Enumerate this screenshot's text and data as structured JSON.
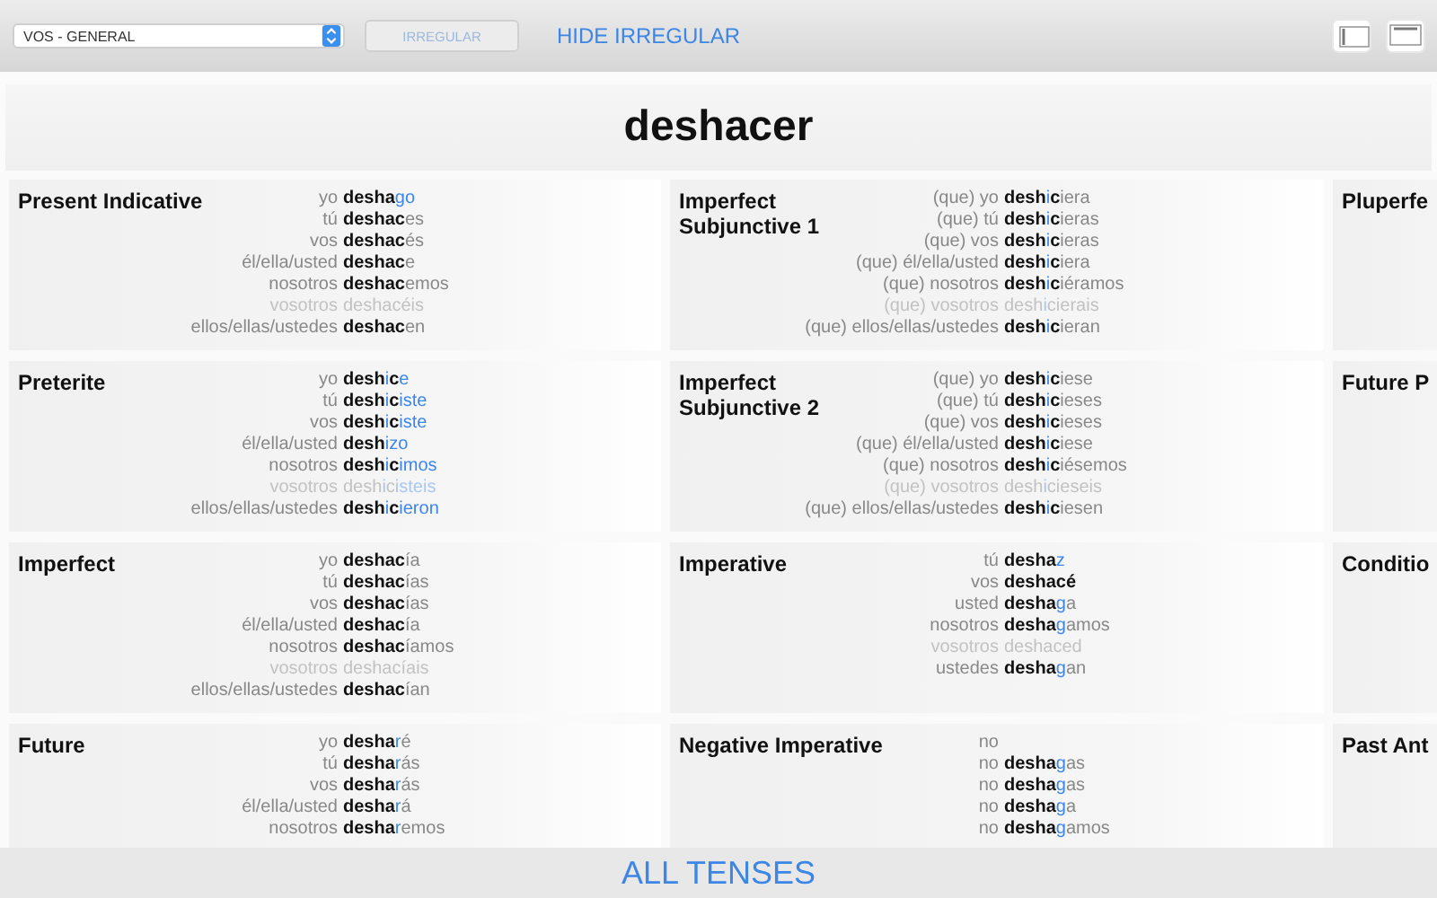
{
  "toolbar": {
    "dropdown": {
      "value": "VOS - GENERAL"
    },
    "irregular_button": {
      "label": "IRREGULAR",
      "disabled": true
    },
    "hide_irregular_link": "HIDE IRREGULAR"
  },
  "verb": "deshacer",
  "tenses": [
    {
      "title": "Present Indicative",
      "forms": [
        {
          "pronoun": "yo",
          "faded": false,
          "parts": [
            {
              "text": "desha",
              "kind": "stem"
            },
            {
              "text": "go",
              "kind": "irregular"
            }
          ]
        },
        {
          "pronoun": "tú",
          "faded": false,
          "parts": [
            {
              "text": "deshac",
              "kind": "stem"
            },
            {
              "text": "es",
              "kind": "ending"
            }
          ]
        },
        {
          "pronoun": "vos",
          "faded": false,
          "parts": [
            {
              "text": "deshac",
              "kind": "stem"
            },
            {
              "text": "és",
              "kind": "ending"
            }
          ]
        },
        {
          "pronoun": "él/ella/usted",
          "faded": false,
          "parts": [
            {
              "text": "deshac",
              "kind": "stem"
            },
            {
              "text": "e",
              "kind": "ending"
            }
          ]
        },
        {
          "pronoun": "nosotros",
          "faded": false,
          "parts": [
            {
              "text": "deshac",
              "kind": "stem"
            },
            {
              "text": "emos",
              "kind": "ending"
            }
          ]
        },
        {
          "pronoun": "vosotros",
          "faded": true,
          "parts": [
            {
              "text": "deshac",
              "kind": "stem"
            },
            {
              "text": "éis",
              "kind": "ending"
            }
          ]
        },
        {
          "pronoun": "ellos/ellas/ustedes",
          "faded": false,
          "parts": [
            {
              "text": "deshac",
              "kind": "stem"
            },
            {
              "text": "en",
              "kind": "ending"
            }
          ]
        }
      ]
    },
    {
      "title": "Imperfect Subjunctive 1",
      "forms": [
        {
          "pronoun": "(que) yo",
          "faded": false,
          "parts": [
            {
              "text": "desh",
              "kind": "stem"
            },
            {
              "text": "i",
              "kind": "irregular"
            },
            {
              "text": "c",
              "kind": "stem"
            },
            {
              "text": "iera",
              "kind": "ending"
            }
          ]
        },
        {
          "pronoun": "(que) tú",
          "faded": false,
          "parts": [
            {
              "text": "desh",
              "kind": "stem"
            },
            {
              "text": "i",
              "kind": "irregular"
            },
            {
              "text": "c",
              "kind": "stem"
            },
            {
              "text": "ieras",
              "kind": "ending"
            }
          ]
        },
        {
          "pronoun": "(que) vos",
          "faded": false,
          "parts": [
            {
              "text": "desh",
              "kind": "stem"
            },
            {
              "text": "i",
              "kind": "irregular"
            },
            {
              "text": "c",
              "kind": "stem"
            },
            {
              "text": "ieras",
              "kind": "ending"
            }
          ]
        },
        {
          "pronoun": "(que) él/ella/usted",
          "faded": false,
          "parts": [
            {
              "text": "desh",
              "kind": "stem"
            },
            {
              "text": "i",
              "kind": "irregular"
            },
            {
              "text": "c",
              "kind": "stem"
            },
            {
              "text": "iera",
              "kind": "ending"
            }
          ]
        },
        {
          "pronoun": "(que) nosotros",
          "faded": false,
          "parts": [
            {
              "text": "desh",
              "kind": "stem"
            },
            {
              "text": "i",
              "kind": "irregular"
            },
            {
              "text": "c",
              "kind": "stem"
            },
            {
              "text": "iéramos",
              "kind": "ending"
            }
          ]
        },
        {
          "pronoun": "(que) vosotros",
          "faded": true,
          "parts": [
            {
              "text": "desh",
              "kind": "stem"
            },
            {
              "text": "i",
              "kind": "irregular"
            },
            {
              "text": "c",
              "kind": "stem"
            },
            {
              "text": "ierais",
              "kind": "ending"
            }
          ]
        },
        {
          "pronoun": "(que) ellos/ellas/ustedes",
          "faded": false,
          "parts": [
            {
              "text": "desh",
              "kind": "stem"
            },
            {
              "text": "i",
              "kind": "irregular"
            },
            {
              "text": "c",
              "kind": "stem"
            },
            {
              "text": "ieran",
              "kind": "ending"
            }
          ]
        }
      ]
    },
    {
      "title": "Pluperfe"
    },
    {
      "title": "Preterite",
      "forms": [
        {
          "pronoun": "yo",
          "faded": false,
          "parts": [
            {
              "text": "desh",
              "kind": "stem"
            },
            {
              "text": "i",
              "kind": "irregular"
            },
            {
              "text": "c",
              "kind": "stem"
            },
            {
              "text": "e",
              "kind": "irregular"
            }
          ]
        },
        {
          "pronoun": "tú",
          "faded": false,
          "parts": [
            {
              "text": "desh",
              "kind": "stem"
            },
            {
              "text": "i",
              "kind": "irregular"
            },
            {
              "text": "c",
              "kind": "stem"
            },
            {
              "text": "iste",
              "kind": "irregular"
            }
          ]
        },
        {
          "pronoun": "vos",
          "faded": false,
          "parts": [
            {
              "text": "desh",
              "kind": "stem"
            },
            {
              "text": "i",
              "kind": "irregular"
            },
            {
              "text": "c",
              "kind": "stem"
            },
            {
              "text": "iste",
              "kind": "irregular"
            }
          ]
        },
        {
          "pronoun": "él/ella/usted",
          "faded": false,
          "parts": [
            {
              "text": "desh",
              "kind": "stem"
            },
            {
              "text": "izo",
              "kind": "irregular"
            }
          ]
        },
        {
          "pronoun": "nosotros",
          "faded": false,
          "parts": [
            {
              "text": "desh",
              "kind": "stem"
            },
            {
              "text": "i",
              "kind": "irregular"
            },
            {
              "text": "c",
              "kind": "stem"
            },
            {
              "text": "imos",
              "kind": "irregular"
            }
          ]
        },
        {
          "pronoun": "vosotros",
          "faded": true,
          "parts": [
            {
              "text": "desh",
              "kind": "stem"
            },
            {
              "text": "i",
              "kind": "irregular"
            },
            {
              "text": "c",
              "kind": "stem"
            },
            {
              "text": "isteis",
              "kind": "irregular"
            }
          ]
        },
        {
          "pronoun": "ellos/ellas/ustedes",
          "faded": false,
          "parts": [
            {
              "text": "desh",
              "kind": "stem"
            },
            {
              "text": "i",
              "kind": "irregular"
            },
            {
              "text": "c",
              "kind": "stem"
            },
            {
              "text": "ieron",
              "kind": "irregular"
            }
          ]
        }
      ]
    },
    {
      "title": "Imperfect Subjunctive 2",
      "forms": [
        {
          "pronoun": "(que) yo",
          "faded": false,
          "parts": [
            {
              "text": "desh",
              "kind": "stem"
            },
            {
              "text": "i",
              "kind": "irregular"
            },
            {
              "text": "c",
              "kind": "stem"
            },
            {
              "text": "iese",
              "kind": "ending"
            }
          ]
        },
        {
          "pronoun": "(que) tú",
          "faded": false,
          "parts": [
            {
              "text": "desh",
              "kind": "stem"
            },
            {
              "text": "i",
              "kind": "irregular"
            },
            {
              "text": "c",
              "kind": "stem"
            },
            {
              "text": "ieses",
              "kind": "ending"
            }
          ]
        },
        {
          "pronoun": "(que) vos",
          "faded": false,
          "parts": [
            {
              "text": "desh",
              "kind": "stem"
            },
            {
              "text": "i",
              "kind": "irregular"
            },
            {
              "text": "c",
              "kind": "stem"
            },
            {
              "text": "ieses",
              "kind": "ending"
            }
          ]
        },
        {
          "pronoun": "(que) él/ella/usted",
          "faded": false,
          "parts": [
            {
              "text": "desh",
              "kind": "stem"
            },
            {
              "text": "i",
              "kind": "irregular"
            },
            {
              "text": "c",
              "kind": "stem"
            },
            {
              "text": "iese",
              "kind": "ending"
            }
          ]
        },
        {
          "pronoun": "(que) nosotros",
          "faded": false,
          "parts": [
            {
              "text": "desh",
              "kind": "stem"
            },
            {
              "text": "i",
              "kind": "irregular"
            },
            {
              "text": "c",
              "kind": "stem"
            },
            {
              "text": "iésemos",
              "kind": "ending"
            }
          ]
        },
        {
          "pronoun": "(que) vosotros",
          "faded": true,
          "parts": [
            {
              "text": "desh",
              "kind": "stem"
            },
            {
              "text": "i",
              "kind": "irregular"
            },
            {
              "text": "c",
              "kind": "stem"
            },
            {
              "text": "ieseis",
              "kind": "ending"
            }
          ]
        },
        {
          "pronoun": "(que) ellos/ellas/ustedes",
          "faded": false,
          "parts": [
            {
              "text": "desh",
              "kind": "stem"
            },
            {
              "text": "i",
              "kind": "irregular"
            },
            {
              "text": "c",
              "kind": "stem"
            },
            {
              "text": "iesen",
              "kind": "ending"
            }
          ]
        }
      ]
    },
    {
      "title": "Future P"
    },
    {
      "title": "Imperfect",
      "forms": [
        {
          "pronoun": "yo",
          "faded": false,
          "parts": [
            {
              "text": "deshac",
              "kind": "stem"
            },
            {
              "text": "ía",
              "kind": "ending"
            }
          ]
        },
        {
          "pronoun": "tú",
          "faded": false,
          "parts": [
            {
              "text": "deshac",
              "kind": "stem"
            },
            {
              "text": "ías",
              "kind": "ending"
            }
          ]
        },
        {
          "pronoun": "vos",
          "faded": false,
          "parts": [
            {
              "text": "deshac",
              "kind": "stem"
            },
            {
              "text": "ías",
              "kind": "ending"
            }
          ]
        },
        {
          "pronoun": "él/ella/usted",
          "faded": false,
          "parts": [
            {
              "text": "deshac",
              "kind": "stem"
            },
            {
              "text": "ía",
              "kind": "ending"
            }
          ]
        },
        {
          "pronoun": "nosotros",
          "faded": false,
          "parts": [
            {
              "text": "deshac",
              "kind": "stem"
            },
            {
              "text": "íamos",
              "kind": "ending"
            }
          ]
        },
        {
          "pronoun": "vosotros",
          "faded": true,
          "parts": [
            {
              "text": "deshac",
              "kind": "stem"
            },
            {
              "text": "íais",
              "kind": "ending"
            }
          ]
        },
        {
          "pronoun": "ellos/ellas/ustedes",
          "faded": false,
          "parts": [
            {
              "text": "deshac",
              "kind": "stem"
            },
            {
              "text": "ían",
              "kind": "ending"
            }
          ]
        }
      ]
    },
    {
      "title": "Imperative",
      "forms": [
        {
          "pronoun": "tú",
          "faded": false,
          "parts": [
            {
              "text": "desha",
              "kind": "stem"
            },
            {
              "text": "z",
              "kind": "irregular"
            }
          ]
        },
        {
          "pronoun": "vos",
          "faded": false,
          "parts": [
            {
              "text": "deshacé",
              "kind": "stem"
            }
          ]
        },
        {
          "pronoun": "usted",
          "faded": false,
          "parts": [
            {
              "text": "desha",
              "kind": "stem"
            },
            {
              "text": "g",
              "kind": "irregular"
            },
            {
              "text": "a",
              "kind": "ending"
            }
          ]
        },
        {
          "pronoun": "nosotros",
          "faded": false,
          "parts": [
            {
              "text": "desha",
              "kind": "stem"
            },
            {
              "text": "g",
              "kind": "irregular"
            },
            {
              "text": "amos",
              "kind": "ending"
            }
          ]
        },
        {
          "pronoun": "vosotros",
          "faded": true,
          "parts": [
            {
              "text": "deshaced",
              "kind": "stem"
            }
          ]
        },
        {
          "pronoun": "ustedes",
          "faded": false,
          "parts": [
            {
              "text": "desha",
              "kind": "stem"
            },
            {
              "text": "g",
              "kind": "irregular"
            },
            {
              "text": "an",
              "kind": "ending"
            }
          ]
        }
      ]
    },
    {
      "title": "Conditio"
    },
    {
      "title": "Future",
      "forms": [
        {
          "pronoun": "yo",
          "faded": false,
          "parts": [
            {
              "text": "desha",
              "kind": "stem"
            },
            {
              "text": "r",
              "kind": "irregular"
            },
            {
              "text": "é",
              "kind": "ending"
            }
          ]
        },
        {
          "pronoun": "tú",
          "faded": false,
          "parts": [
            {
              "text": "desha",
              "kind": "stem"
            },
            {
              "text": "r",
              "kind": "irregular"
            },
            {
              "text": "ás",
              "kind": "ending"
            }
          ]
        },
        {
          "pronoun": "vos",
          "faded": false,
          "parts": [
            {
              "text": "desha",
              "kind": "stem"
            },
            {
              "text": "r",
              "kind": "irregular"
            },
            {
              "text": "ás",
              "kind": "ending"
            }
          ]
        },
        {
          "pronoun": "él/ella/usted",
          "faded": false,
          "parts": [
            {
              "text": "desha",
              "kind": "stem"
            },
            {
              "text": "r",
              "kind": "irregular"
            },
            {
              "text": "á",
              "kind": "ending"
            }
          ]
        },
        {
          "pronoun": "nosotros",
          "faded": false,
          "parts": [
            {
              "text": "desha",
              "kind": "stem"
            },
            {
              "text": "r",
              "kind": "irregular"
            },
            {
              "text": "emos",
              "kind": "ending"
            }
          ]
        }
      ]
    },
    {
      "title": "Negative Imperative",
      "forms": [
        {
          "pronoun": "no",
          "faded": false
        },
        {
          "pronoun": "no",
          "faded": false,
          "parts": [
            {
              "text": "desha",
              "kind": "stem"
            },
            {
              "text": "g",
              "kind": "irregular"
            },
            {
              "text": "as",
              "kind": "ending"
            }
          ]
        },
        {
          "pronoun": "no",
          "faded": false,
          "parts": [
            {
              "text": "desha",
              "kind": "stem"
            },
            {
              "text": "g",
              "kind": "irregular"
            },
            {
              "text": "as",
              "kind": "ending"
            }
          ]
        },
        {
          "pronoun": "no",
          "faded": false,
          "parts": [
            {
              "text": "desha",
              "kind": "stem"
            },
            {
              "text": "g",
              "kind": "irregular"
            },
            {
              "text": "a",
              "kind": "ending"
            }
          ]
        },
        {
          "pronoun": "no",
          "faded": false,
          "parts": [
            {
              "text": "desha",
              "kind": "stem"
            },
            {
              "text": "g",
              "kind": "irregular"
            },
            {
              "text": "amos",
              "kind": "ending"
            }
          ]
        }
      ]
    },
    {
      "title": "Past Ant"
    }
  ],
  "bottom_bar": {
    "label": "ALL TENSES"
  }
}
